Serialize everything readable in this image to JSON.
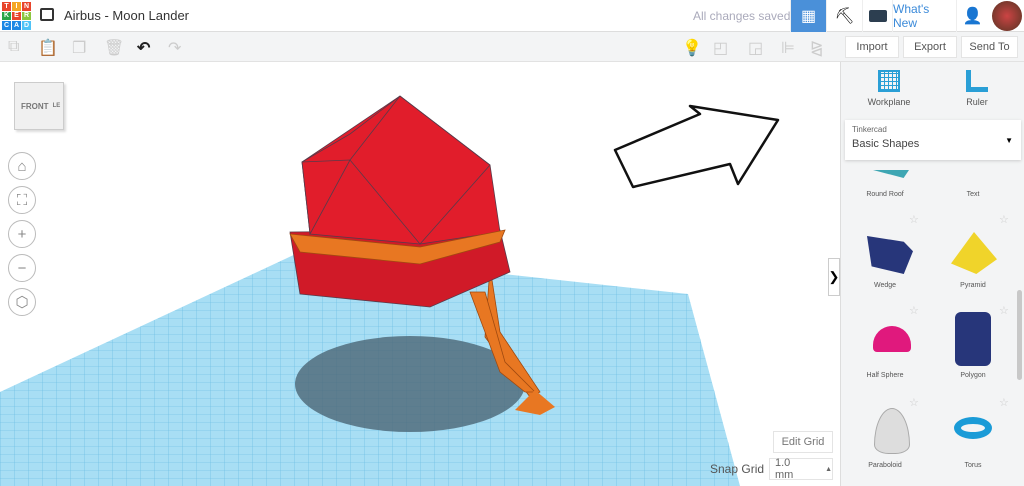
{
  "app": {
    "logo": [
      "T",
      "I",
      "N",
      "K",
      "E",
      "R",
      "C",
      "A",
      "D"
    ],
    "title": "Airbus - Moon Lander",
    "status": "All changes saved",
    "whats_new": "What's New"
  },
  "toolbar": {
    "import": "Import",
    "export": "Export",
    "send_to": "Send To"
  },
  "viewcube": {
    "front": "FRONT",
    "side": "LE"
  },
  "grid": {
    "edit": "Edit Grid",
    "snap_label": "Snap Grid",
    "snap_value": "1.0 mm"
  },
  "panel": {
    "workplane": "Workplane",
    "ruler": "Ruler",
    "library_label": "Tinkercad",
    "library_value": "Basic Shapes",
    "shapes": [
      {
        "name": "Round Roof"
      },
      {
        "name": "Text"
      },
      {
        "name": "Wedge"
      },
      {
        "name": "Pyramid"
      },
      {
        "name": "Half Sphere"
      },
      {
        "name": "Polygon"
      },
      {
        "name": "Paraboloid"
      },
      {
        "name": "Torus"
      }
    ]
  },
  "colors": {
    "accent": "#4a90d9",
    "object": "#e11d2b",
    "legs": "#e87722",
    "grid": "#8fd3ef"
  }
}
